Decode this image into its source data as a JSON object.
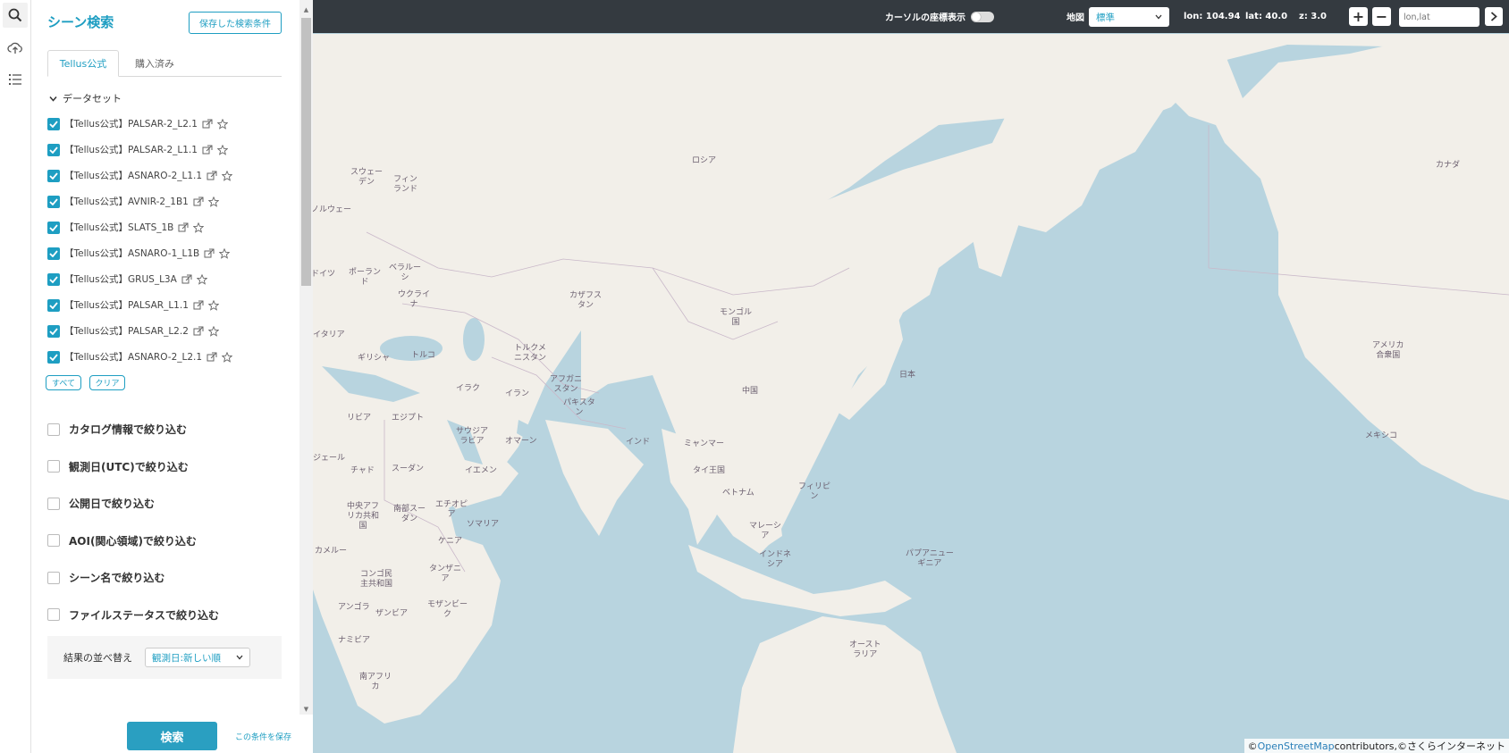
{
  "rail": {
    "icons": [
      "search-icon",
      "cloud-upload-icon",
      "list-icon"
    ]
  },
  "panel": {
    "title": "シーン検索",
    "saved_button": "保存した検索条件",
    "tabs": [
      {
        "label": "Tellus公式",
        "active": true
      },
      {
        "label": "購入済み",
        "active": false
      }
    ],
    "dataset_header": "データセット",
    "datasets": [
      {
        "label": "【Tellus公式】PALSAR-2_L2.1",
        "checked": true
      },
      {
        "label": "【Tellus公式】PALSAR-2_L1.1",
        "checked": true
      },
      {
        "label": "【Tellus公式】ASNARO-2_L1.1",
        "checked": true
      },
      {
        "label": "【Tellus公式】AVNIR-2_1B1",
        "checked": true
      },
      {
        "label": "【Tellus公式】SLATS_1B",
        "checked": true
      },
      {
        "label": "【Tellus公式】ASNARO-1_L1B",
        "checked": true
      },
      {
        "label": "【Tellus公式】GRUS_L3A",
        "checked": true
      },
      {
        "label": "【Tellus公式】PALSAR_L1.1",
        "checked": true
      },
      {
        "label": "【Tellus公式】PALSAR_L2.2",
        "checked": true
      },
      {
        "label": "【Tellus公式】ASNARO-2_L2.1",
        "checked": true
      }
    ],
    "select_all": "すべて",
    "clear": "クリア",
    "filters": [
      {
        "label": "カタログ情報で絞り込む",
        "checked": false
      },
      {
        "label": "観測日(UTC)で絞り込む",
        "checked": false
      },
      {
        "label": "公開日で絞り込む",
        "checked": false
      },
      {
        "label": "AOI(関心領域)で絞り込む",
        "checked": false
      },
      {
        "label": "シーン名で絞り込む",
        "checked": false
      },
      {
        "label": "ファイルステータスで絞り込む",
        "checked": false
      }
    ],
    "sort_label": "結果の並べ替え",
    "sort_value": "観測日:新しい順",
    "search_button": "検索",
    "save_condition": "この条件を保存"
  },
  "topbar": {
    "cursor_coords_label": "カーソルの座標表示",
    "cursor_coords_enabled": false,
    "basemap_label": "地図",
    "basemap_value": "標準",
    "lon": "lon: 104.94",
    "lat": "lat: 40.0",
    "zoom": "z: 3.0",
    "zoom_in": "+",
    "zoom_out": "−",
    "coord_placeholder": "lon,lat"
  },
  "map": {
    "labels": [
      {
        "text": "ロシア",
        "type": "country"
      },
      {
        "text": "カナダ",
        "type": "country"
      },
      {
        "text": "スウェー\nデン",
        "type": "country"
      },
      {
        "text": "フィン\nランド",
        "type": "country"
      },
      {
        "text": "ノルウェー",
        "type": "country"
      },
      {
        "text": "ベラルー\nシ",
        "type": "country"
      },
      {
        "text": "ポーラン\nド",
        "type": "country"
      },
      {
        "text": "ドイツ",
        "type": "country"
      },
      {
        "text": "ウクライ\nナ",
        "type": "country"
      },
      {
        "text": "カザフス\nタン",
        "type": "country"
      },
      {
        "text": "モンゴル\n国",
        "type": "country"
      },
      {
        "text": "イタリア",
        "type": "country"
      },
      {
        "text": "ギリシャ",
        "type": "country"
      },
      {
        "text": "トルコ",
        "type": "country"
      },
      {
        "text": "トルクメ\nニスタン",
        "type": "country"
      },
      {
        "text": "日本",
        "type": "country"
      },
      {
        "text": "中国",
        "type": "country"
      },
      {
        "text": "イラク",
        "type": "country"
      },
      {
        "text": "イラン",
        "type": "country"
      },
      {
        "text": "アフガニ\nスタン",
        "type": "country"
      },
      {
        "text": "パキスタ\nン",
        "type": "country"
      },
      {
        "text": "アメリカ\n合衆国",
        "type": "country"
      },
      {
        "text": "リビア",
        "type": "country"
      },
      {
        "text": "エジプト",
        "type": "country"
      },
      {
        "text": "サウジア\nラビア",
        "type": "country"
      },
      {
        "text": "オマーン",
        "type": "country"
      },
      {
        "text": "インド",
        "type": "country"
      },
      {
        "text": "ミャンマー",
        "type": "country"
      },
      {
        "text": "メキシコ",
        "type": "country"
      },
      {
        "text": "タイ王国",
        "type": "country"
      },
      {
        "text": "フィリピ\nン",
        "type": "country"
      },
      {
        "text": "ベトナム",
        "type": "country"
      },
      {
        "text": "ジェール",
        "type": "country"
      },
      {
        "text": "チャド",
        "type": "country"
      },
      {
        "text": "スーダン",
        "type": "country"
      },
      {
        "text": "イエメン",
        "type": "country"
      },
      {
        "text": "中央アフ\nリカ共和\n国",
        "type": "country"
      },
      {
        "text": "南部スー\nダン",
        "type": "country"
      },
      {
        "text": "エチオピ\nア",
        "type": "country"
      },
      {
        "text": "ソマリア",
        "type": "country"
      },
      {
        "text": "マレーシ\nア",
        "type": "country"
      },
      {
        "text": "カメルー",
        "type": "country"
      },
      {
        "text": "ケニア",
        "type": "country"
      },
      {
        "text": "インドネ\nシア",
        "type": "country"
      },
      {
        "text": "パプアニュー\nギニア",
        "type": "country"
      },
      {
        "text": "コンゴ民\n主共和国",
        "type": "country"
      },
      {
        "text": "タンザニ\nア",
        "type": "country"
      },
      {
        "text": "アンゴラ",
        "type": "country"
      },
      {
        "text": "ザンビア",
        "type": "country"
      },
      {
        "text": "モザンビー\nク",
        "type": "country"
      },
      {
        "text": "ナミビア",
        "type": "country"
      },
      {
        "text": "オースト\nラリア",
        "type": "country"
      },
      {
        "text": "南アフリ\nカ",
        "type": "country"
      }
    ]
  },
  "attribution": {
    "prefix": "©",
    "link": "OpenStreetMap",
    "suffix": " contributors,©さくらインターネット"
  }
}
